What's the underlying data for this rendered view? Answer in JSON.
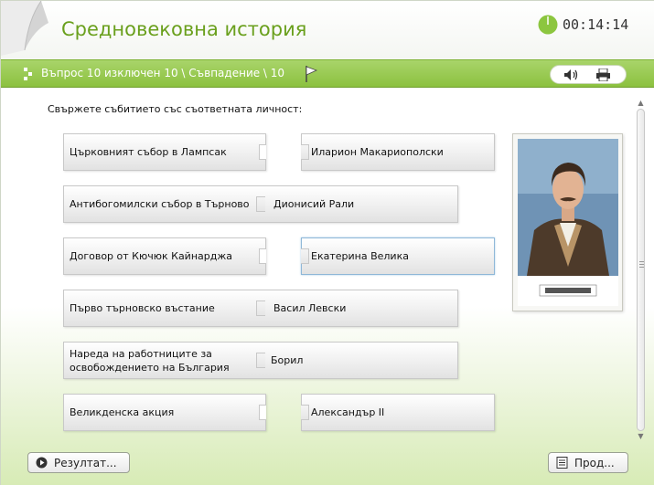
{
  "header": {
    "title": "Средновековна история",
    "timer": "00:14:14"
  },
  "question_bar": {
    "text": "Въпрос 10 изключен 10 \\ Съвпадение \\ 10"
  },
  "instruction": "Свържете събитието със съответната личност:",
  "pairs": [
    {
      "left": "Църковният събор в Лампсак",
      "right": "Иларион Макариополски",
      "state": "separate"
    },
    {
      "left": "Антибогомилски събор в Търново",
      "right": "Дионисий Рали",
      "state": "joined"
    },
    {
      "left": "Договор от Кючюк Кайнарджа",
      "right": "Екатерина Велика",
      "state": "separate-selected"
    },
    {
      "left": "Първо търновско въстание",
      "right": "Васил Левски",
      "state": "joined"
    },
    {
      "left": "Нареда на работниците за освобождението на България",
      "right": "Борил",
      "state": "joined"
    },
    {
      "left": "Великденска акция",
      "right": "Александър II",
      "state": "separate"
    }
  ],
  "buttons": {
    "result": "Резултат...",
    "next": "Прод..."
  },
  "icons": {
    "timer": "timer-icon",
    "flag": "flag-icon",
    "sound": "speaker-icon",
    "print": "printer-icon",
    "play": "play-icon",
    "list": "list-icon"
  },
  "colors": {
    "title_green": "#6aa01d",
    "bar_green": "#8cc13f",
    "timer_green": "#8cc63f"
  }
}
